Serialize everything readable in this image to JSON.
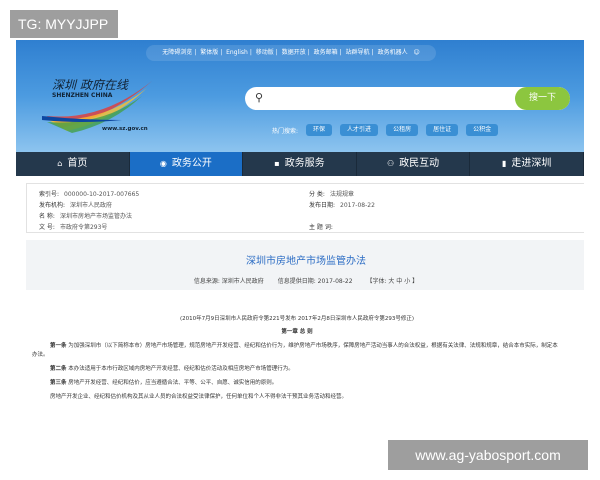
{
  "watermarks": {
    "top": "TG: MYYJJPP",
    "bottom": "www.ag-yabosport.com"
  },
  "top_links": [
    "无障碍浏览",
    "繁体版",
    "English",
    "移动版",
    "数据开放",
    "政务邮箱",
    "站群导航",
    "政务机器人"
  ],
  "logo": {
    "cn": "深圳 政府在线",
    "en": "SHENZHEN CHINA",
    "url": "www.sz.gov.cn"
  },
  "search": {
    "button": "搜一下",
    "placeholder": ""
  },
  "hot": {
    "label": "热门搜索:",
    "tags": [
      "环保",
      "人才引进",
      "公租房",
      "居住证",
      "公积金"
    ]
  },
  "nav": [
    {
      "label": "首页",
      "icon": "home-icon"
    },
    {
      "label": "政务公开",
      "icon": "eye-icon",
      "active": true
    },
    {
      "label": "政务服务",
      "icon": "monitor-icon"
    },
    {
      "label": "政民互动",
      "icon": "people-icon"
    },
    {
      "label": "走进深圳",
      "icon": "building-icon"
    }
  ],
  "info": {
    "index_label": "索引号:",
    "index": "000000-10-2017-007665",
    "category_label": "分 类:",
    "category": "法规规章",
    "org_label": "发布机构:",
    "org": "深圳市人民政府",
    "date_label": "发布日期:",
    "date": "2017-08-22",
    "name_label": "名 称:",
    "name": "深圳市房地产市场监管办法",
    "doc_label": "文 号:",
    "doc": "市政府令第293号",
    "subject_label": "主 题 词:",
    "subject": ""
  },
  "article": {
    "title": "深圳市房地产市场监管办法",
    "source": "信息来源: 深圳市人民政府",
    "provided": "信息提供日期: 2017-08-22",
    "fontsize": "【字体: 大 中 小 】",
    "note": "(2010年7月9日深圳市人民政府令第221号发布 2017年2月8日深圳市人民政府令第293号修正)",
    "chapter": "第一章 总 则",
    "paras": [
      {
        "head": "第一条",
        "text": "为加强深圳市（以下简称本市）房地产市场管理，规范房地产开发经营、经纪和估价行为，维护房地产市场秩序，保障房地产活动当事人的合法权益，根据有关法律、法规和规章，结合本市实际，制定本办法。"
      },
      {
        "head": "第二条",
        "text": "本办法适用于本市行政区域内房地产开发经营、经纪和估价活动及相应房地产市场管理行为。"
      },
      {
        "head": "第三条",
        "text": "房地产开发经营、经纪和估价，应当遵循合法、平等、公平、自愿、诚实信用的原则。"
      },
      {
        "head": "",
        "text": "房地产开发企业、经纪和估价机构及其从业人员的合法权益受法律保护，任何单位和个人不得非法干预其业务活动和经营。"
      }
    ]
  }
}
